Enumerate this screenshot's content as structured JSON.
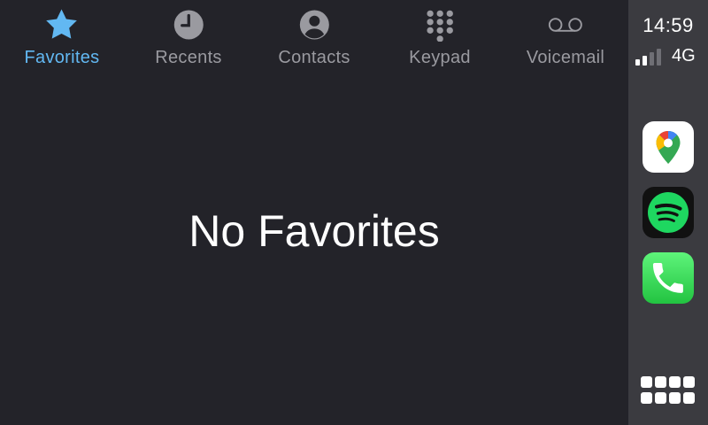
{
  "tabs": [
    {
      "id": "favorites",
      "label": "Favorites",
      "icon": "star-icon",
      "active": true
    },
    {
      "id": "recents",
      "label": "Recents",
      "icon": "clock-icon",
      "active": false
    },
    {
      "id": "contacts",
      "label": "Contacts",
      "icon": "person-circle-icon",
      "active": false
    },
    {
      "id": "keypad",
      "label": "Keypad",
      "icon": "keypad-icon",
      "active": false
    },
    {
      "id": "voicemail",
      "label": "Voicemail",
      "icon": "voicemail-icon",
      "active": false
    }
  ],
  "main": {
    "empty_message": "No Favorites"
  },
  "status": {
    "time": "14:59",
    "network": "4G",
    "signal_bars_filled": 2,
    "signal_bars_total": 4
  },
  "dock": {
    "apps": [
      {
        "name": "Google Maps",
        "icon": "google-maps-icon"
      },
      {
        "name": "Spotify",
        "icon": "spotify-icon"
      },
      {
        "name": "Phone",
        "icon": "phone-icon"
      }
    ],
    "home_icon": "app-grid-icon"
  },
  "colors": {
    "accent": "#62b8f2",
    "inactive": "#9a9aa0",
    "background": "#232329",
    "dock": "#3b3b40"
  }
}
